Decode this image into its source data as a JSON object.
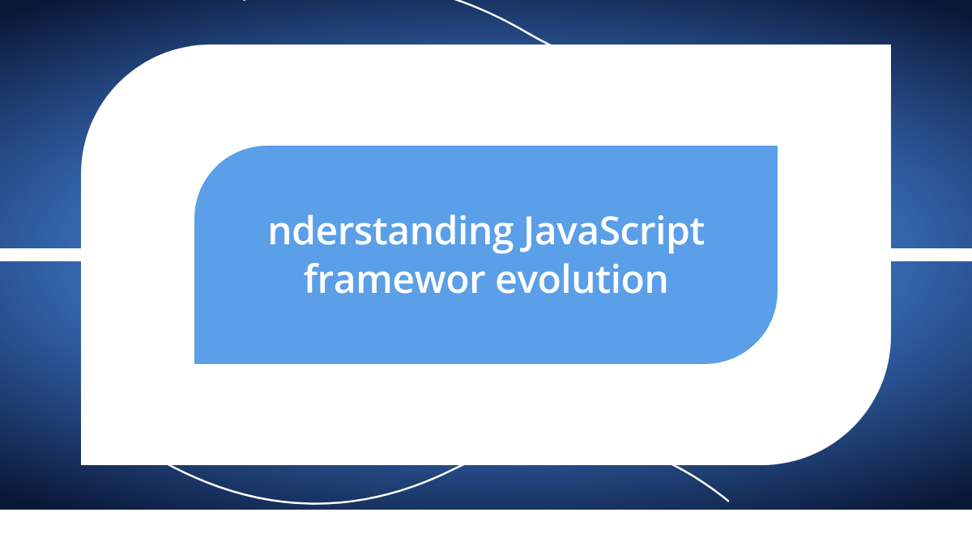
{
  "card": {
    "title": "nderstanding JavaScript framewor evolution"
  },
  "colors": {
    "bg_center": "#5a9fe8",
    "bg_edge": "#0a1838",
    "shape": "#ffffff",
    "inner": "#5a9fe8",
    "text": "#ffffff"
  }
}
